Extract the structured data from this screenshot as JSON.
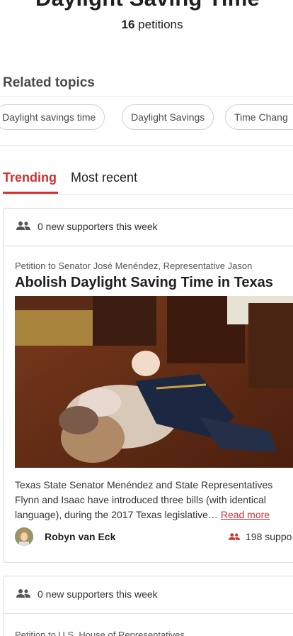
{
  "header": {
    "title": "Daylight Saving Time",
    "count": "16",
    "count_label": "petitions"
  },
  "related": {
    "heading": "Related topics",
    "chips": [
      "Daylight savings time",
      "Daylight Savings",
      "Time Chang"
    ]
  },
  "tabs": {
    "trending": "Trending",
    "recent": "Most recent"
  },
  "cards": [
    {
      "week_text": "0 new supporters this week",
      "target": "Petition to Senator José Menéndez, Representative Jason",
      "headline": "Abolish Daylight Saving Time in Texas",
      "description": "Texas State Senator Menéndez and State Representatives Flynn and Isaac have introduced three bills (with identical language), during the 2017 Texas legislative… ",
      "read_more": "Read more",
      "author": "Robyn van Eck",
      "supporters": "198 suppo"
    },
    {
      "week_text": "0 new supporters this week",
      "target": "Petition to U.S. House of Representatives"
    }
  ],
  "colors": {
    "accent": "#d3302f",
    "border": "#dddddd",
    "text": "#1f1f1f"
  }
}
